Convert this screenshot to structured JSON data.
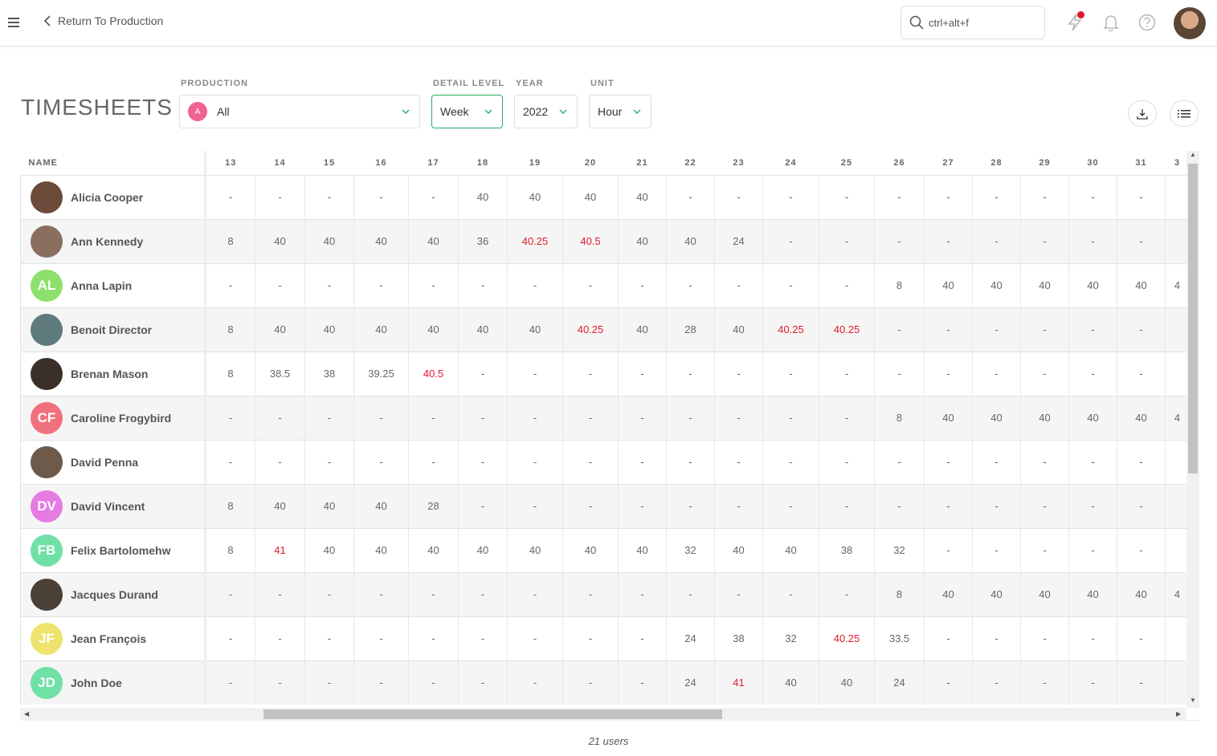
{
  "header": {
    "back_label": "Return To Production",
    "search_value": "ctrl+alt+f"
  },
  "page": {
    "title": "TIMESHEETS",
    "filters": {
      "production_label": "PRODUCTION",
      "production_badge": "A",
      "production_value": "All",
      "detail_label": "DETAIL LEVEL",
      "detail_value": "Week",
      "year_label": "YEAR",
      "year_value": "2022",
      "unit_label": "UNIT",
      "unit_value": "Hour"
    }
  },
  "table": {
    "name_header": "NAME",
    "weeks": [
      "13",
      "14",
      "15",
      "16",
      "17",
      "18",
      "19",
      "20",
      "21",
      "22",
      "23",
      "24",
      "25",
      "26",
      "27",
      "28",
      "29",
      "30",
      "31",
      "3"
    ],
    "overtime_color": "#e0192a",
    "rows": [
      {
        "name": "Alicia Cooper",
        "initials": "",
        "avatar_color": "#6b4b3a",
        "values": [
          "-",
          "-",
          "-",
          "-",
          "-",
          "40",
          "40",
          "40",
          "40",
          "-",
          "-",
          "-",
          "-",
          "-",
          "-",
          "-",
          "-",
          "-",
          "-",
          ""
        ]
      },
      {
        "name": "Ann Kennedy",
        "initials": "",
        "avatar_color": "#8a6f5e",
        "values": [
          "8",
          "40",
          "40",
          "40",
          "40",
          "36",
          "40.25",
          "40.5",
          "40",
          "40",
          "24",
          "-",
          "-",
          "-",
          "-",
          "-",
          "-",
          "-",
          "-",
          ""
        ]
      },
      {
        "name": "Anna Lapin",
        "initials": "AL",
        "avatar_color": "#8ee06c",
        "values": [
          "-",
          "-",
          "-",
          "-",
          "-",
          "-",
          "-",
          "-",
          "-",
          "-",
          "-",
          "-",
          "-",
          "8",
          "40",
          "40",
          "40",
          "40",
          "40",
          "4"
        ]
      },
      {
        "name": "Benoit Director",
        "initials": "",
        "avatar_color": "#5f7a7c",
        "values": [
          "8",
          "40",
          "40",
          "40",
          "40",
          "40",
          "40",
          "40.25",
          "40",
          "28",
          "40",
          "40.25",
          "40.25",
          "-",
          "-",
          "-",
          "-",
          "-",
          "-",
          ""
        ]
      },
      {
        "name": "Brenan Mason",
        "initials": "",
        "avatar_color": "#3b3029",
        "values": [
          "8",
          "38.5",
          "38",
          "39.25",
          "40.5",
          "-",
          "-",
          "-",
          "-",
          "-",
          "-",
          "-",
          "-",
          "-",
          "-",
          "-",
          "-",
          "-",
          "-",
          ""
        ]
      },
      {
        "name": "Caroline Frogybird",
        "initials": "CF",
        "avatar_color": "#f0717d",
        "values": [
          "-",
          "-",
          "-",
          "-",
          "-",
          "-",
          "-",
          "-",
          "-",
          "-",
          "-",
          "-",
          "-",
          "8",
          "40",
          "40",
          "40",
          "40",
          "40",
          "4"
        ]
      },
      {
        "name": "David Penna",
        "initials": "",
        "avatar_color": "#6e5a4a",
        "values": [
          "-",
          "-",
          "-",
          "-",
          "-",
          "-",
          "-",
          "-",
          "-",
          "-",
          "-",
          "-",
          "-",
          "-",
          "-",
          "-",
          "-",
          "-",
          "-",
          ""
        ]
      },
      {
        "name": "David Vincent",
        "initials": "DV",
        "avatar_color": "#e57be3",
        "values": [
          "8",
          "40",
          "40",
          "40",
          "28",
          "-",
          "-",
          "-",
          "-",
          "-",
          "-",
          "-",
          "-",
          "-",
          "-",
          "-",
          "-",
          "-",
          "-",
          ""
        ]
      },
      {
        "name": "Felix Bartolomehw",
        "initials": "FB",
        "avatar_color": "#6fe0a6",
        "values": [
          "8",
          "41",
          "40",
          "40",
          "40",
          "40",
          "40",
          "40",
          "40",
          "32",
          "40",
          "40",
          "38",
          "32",
          "-",
          "-",
          "-",
          "-",
          "-",
          ""
        ]
      },
      {
        "name": "Jacques Durand",
        "initials": "",
        "avatar_color": "#4a4036",
        "values": [
          "-",
          "-",
          "-",
          "-",
          "-",
          "-",
          "-",
          "-",
          "-",
          "-",
          "-",
          "-",
          "-",
          "8",
          "40",
          "40",
          "40",
          "40",
          "40",
          "4"
        ]
      },
      {
        "name": "Jean François",
        "initials": "JF",
        "avatar_color": "#eee36c",
        "values": [
          "-",
          "-",
          "-",
          "-",
          "-",
          "-",
          "-",
          "-",
          "-",
          "24",
          "38",
          "32",
          "40.25",
          "33.5",
          "-",
          "-",
          "-",
          "-",
          "-",
          ""
        ]
      },
      {
        "name": "John Doe",
        "initials": "JD",
        "avatar_color": "#6fe0a6",
        "values": [
          "-",
          "-",
          "-",
          "-",
          "-",
          "-",
          "-",
          "-",
          "-",
          "24",
          "41",
          "40",
          "40",
          "24",
          "-",
          "-",
          "-",
          "-",
          "-",
          ""
        ]
      }
    ],
    "overtime": [
      [
        1,
        6
      ],
      [
        1,
        7
      ],
      [
        3,
        7
      ],
      [
        3,
        11
      ],
      [
        3,
        12
      ],
      [
        4,
        4
      ],
      [
        8,
        1
      ],
      [
        10,
        12
      ],
      [
        11,
        10
      ]
    ]
  },
  "footer": {
    "users_count": "21 users"
  }
}
